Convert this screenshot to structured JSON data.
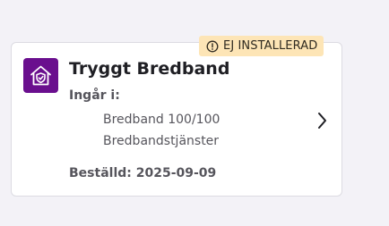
{
  "product": {
    "title": "Tryggt Bredband",
    "icon": "house-shield-icon",
    "status_badge": {
      "text": "EJ INSTALLERAD",
      "icon": "info-circle-icon",
      "color": "#fde5b6"
    },
    "includes_label": "Ingår i:",
    "includes": [
      "Bredband 100/100",
      "Bredbandstjänster"
    ],
    "ordered_label": "Beställd:",
    "ordered_date": "2025-09-09"
  },
  "colors": {
    "brand": "#6a0f8e",
    "background": "#f3f2f7",
    "card": "#ffffff"
  }
}
